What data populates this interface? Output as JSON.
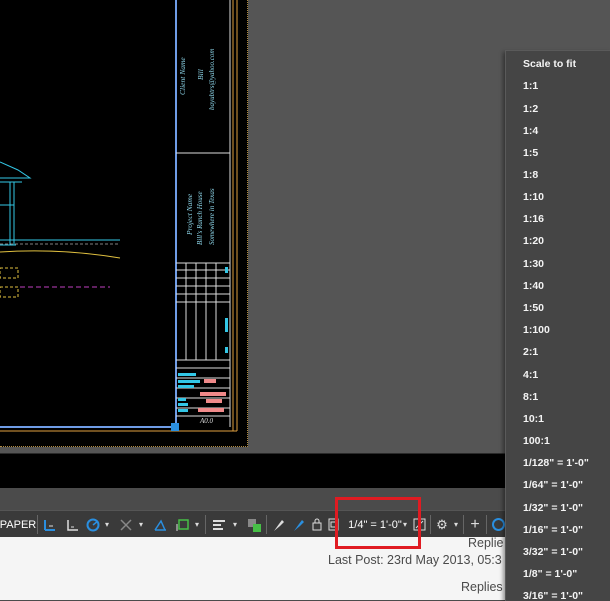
{
  "title_block": {
    "client_label": "Client Name",
    "client_name": "Bill",
    "client_email": "bayubtrs@yahoo.com",
    "project_label": "Project Name",
    "project_name": "Bill's Ranch House",
    "project_location": "Somewhere in Texas",
    "sheet_number": "A0.0"
  },
  "statusbar": {
    "paper_label": "PAPER",
    "scale_label": "1/4\" = 1'-0\"",
    "icons": [
      "snap-icon",
      "ortho-icon",
      "polar-tracking-icon",
      "osnap-icon",
      "dynamic-ucs-icon",
      "dynamic-input-icon",
      "lineweight-icon",
      "selection-cycling-icon",
      "annotation-visibility-icon",
      "auto-scale-icon",
      "lock-icon",
      "viewport-icon",
      "maximize-viewport-icon",
      "gear-icon",
      "plus-icon",
      "annotation-monitor-icon"
    ]
  },
  "scale_menu": {
    "items": [
      "Scale to fit",
      "1:1",
      "1:2",
      "1:4",
      "1:5",
      "1:8",
      "1:10",
      "1:16",
      "1:20",
      "1:30",
      "1:40",
      "1:50",
      "1:100",
      "2:1",
      "4:1",
      "8:1",
      "10:1",
      "100:1",
      "1/128\" = 1'-0\"",
      "1/64\" = 1'-0\"",
      "1/32\" = 1'-0\"",
      "1/16\" = 1'-0\"",
      "3/32\" = 1'-0\"",
      "1/8\" = 1'-0\"",
      "3/16\" = 1'-0\""
    ]
  },
  "forum": {
    "replies_top": "Replie",
    "last_post": "Last Post: 23rd May 2013, 05:3",
    "replies_bottom": "Replies"
  },
  "colors": {
    "menu_bg": "#454545",
    "highlight": "#e01b22",
    "statusbar_bg": "#3a3a3a",
    "icon_blue": "#2a8fe0"
  }
}
